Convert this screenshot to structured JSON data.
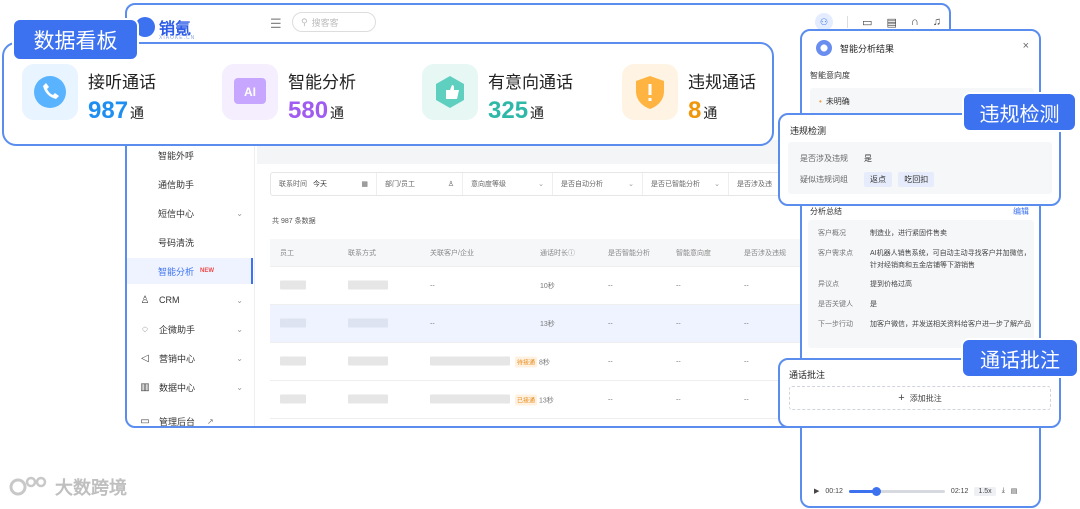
{
  "app": {
    "logo_text": "销氪",
    "logo_sub": "XIAOKE.CN",
    "search_placeholder": "搜客客"
  },
  "sidebar": {
    "sub_items": [
      {
        "label": "智能外呼"
      },
      {
        "label": "通信助手"
      },
      {
        "label": "短信中心"
      },
      {
        "label": "号码清洗"
      },
      {
        "label": "智能分析",
        "badge": "NEW"
      }
    ],
    "main_items": [
      {
        "label": "CRM"
      },
      {
        "label": "企微助手"
      },
      {
        "label": "营销中心"
      },
      {
        "label": "数据中心"
      },
      {
        "label": "管理后台"
      }
    ]
  },
  "filters": {
    "date_label": "联系时间",
    "date_value": "今天",
    "dept": "部门/员工",
    "f1": "意向度等级",
    "f2": "是否自动分析",
    "f3": "是否已智能分析",
    "f4": "是否涉及违"
  },
  "table": {
    "total": "共 987 条数据",
    "headers": [
      "员工",
      "联系方式",
      "关联客户/企业",
      "通话时长",
      "是否智能分析",
      "智能意向度",
      "是否涉及违规"
    ],
    "rows": [
      {
        "related": "--",
        "duration": "10秒",
        "a": "--",
        "b": "--",
        "c": "--"
      },
      {
        "related": "--",
        "duration": "13秒",
        "a": "--",
        "b": "--",
        "c": "--"
      },
      {
        "tag": "待接通",
        "duration": "8秒",
        "a": "--",
        "b": "--",
        "c": "--"
      },
      {
        "tag": "已接通",
        "duration": "13秒",
        "a": "--",
        "b": "--",
        "c": "--"
      }
    ]
  },
  "banner": {
    "tag": "数据看板",
    "stats": [
      {
        "label": "接听通话",
        "value": "987",
        "unit": "通",
        "color": "#1e8ff0"
      },
      {
        "label": "智能分析",
        "value": "580",
        "unit": "通",
        "color": "#a05cf0"
      },
      {
        "label": "有意向通话",
        "value": "325",
        "unit": "通",
        "color": "#2fb8a8"
      },
      {
        "label": "违规通话",
        "value": "8",
        "unit": "通",
        "color": "#f0960a"
      }
    ]
  },
  "panel": {
    "title": "智能分析结果",
    "intent_label": "智能意向度",
    "intent_value": "未明确",
    "summary_label": "分析总结",
    "summary_edit": "编辑",
    "summary": [
      {
        "k": "客户概况",
        "v": "制造业，进行紧固件售卖"
      },
      {
        "k": "客户需求点",
        "v": "AI机器人销售系统，可自动主动寻找客户并加微信，针对经销商和五金店铺等下游销售"
      },
      {
        "k": "异议点",
        "v": "提到价格过高"
      },
      {
        "k": "是否关键人",
        "v": "是"
      },
      {
        "k": "下一步行动",
        "v": "加客户微信，并发送相关资料给客户进一步了解产品"
      }
    ],
    "player": {
      "current": "00:12",
      "total": "02:12",
      "speed": "1.5x",
      "progress": 0.28
    }
  },
  "violation": {
    "tag": "违规检测",
    "title": "违规检测",
    "q_label": "是否涉及违规",
    "q_value": "是",
    "words_label": "疑似违规词组",
    "words": [
      "返点",
      "吃回扣"
    ]
  },
  "annotation": {
    "tag": "通话批注",
    "title": "通话批注",
    "add_label": "添加批注"
  },
  "watermark": {
    "text": "大数跨境"
  }
}
